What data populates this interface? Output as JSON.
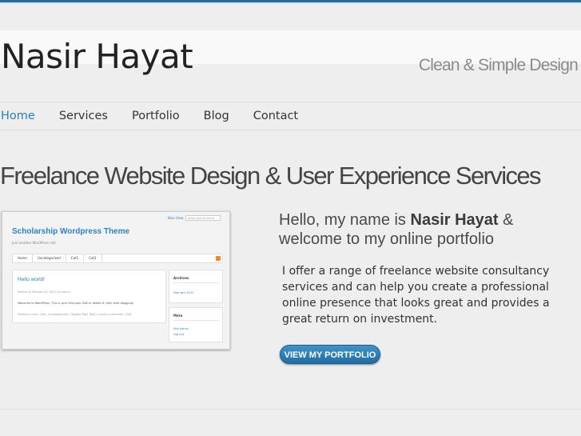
{
  "header": {
    "site_title": "Nasir Hayat",
    "tagline": "Clean & Simple Design"
  },
  "nav": {
    "items": [
      "Home",
      "Services",
      "Portfolio",
      "Blog",
      "Contact"
    ],
    "active": "Home"
  },
  "main": {
    "headline": "Freelance Website Design & User Experience Services",
    "hello_prefix": "Hello, my name is ",
    "hello_name": "Nasir Hayat",
    "hello_suffix": " & welcome to my online portfolio",
    "offer": "I offer a range of freelance website consultancy services and can help you create a professional online presence that looks great and provides a great return on investment.",
    "cta_label": "VIEW MY PORTFOLIO"
  },
  "preview": {
    "title": "Scholarship Wordpress Theme",
    "tagline": "Just another WordPress site",
    "top_links": "Blue  View",
    "search_placeholder": "enter search terms",
    "menu": [
      "Home",
      "Uncategorized",
      "Cat1",
      "Cat2"
    ],
    "post_title": "Hello world!",
    "post_meta": "Posted on February 8, 2011 by admin",
    "post_body": "Welcome to WordPress. This is your first post. Edit or delete it, then start blogging!",
    "post_foot": "Posted in Cat1, Cat2, Uncategorized | Tagged Tag1 Tag2 | Leave a comment | Edit",
    "archives_title": "Archives",
    "archives_item": "February 2011",
    "meta_title": "Meta",
    "meta_items": [
      "Site Admin",
      "Log out"
    ]
  },
  "colors": {
    "accent": "#2a7fb8",
    "top_bar": "#1f6fa0",
    "button": "#2a7fb8"
  }
}
